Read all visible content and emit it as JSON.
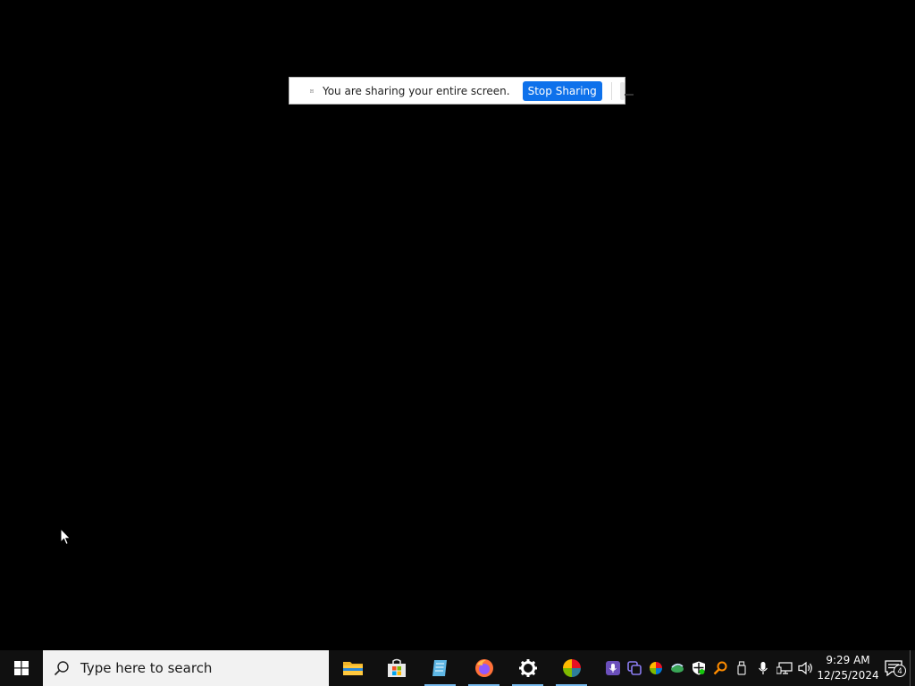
{
  "share_bar": {
    "message": "You are sharing your entire screen.",
    "stop_label": "Stop Sharing"
  },
  "taskbar": {
    "search_placeholder": "Type here to search",
    "apps": [
      {
        "name": "file-explorer",
        "active": false
      },
      {
        "name": "microsoft-store",
        "active": false
      },
      {
        "name": "notepad",
        "active": true
      },
      {
        "name": "firefox",
        "active": true
      },
      {
        "name": "settings",
        "active": true
      },
      {
        "name": "color-app",
        "active": true
      }
    ],
    "clock": {
      "time": "9:29 AM",
      "date": "12/25/2024"
    },
    "notification_count": "4"
  },
  "colors": {
    "accent": "#0e71eb",
    "taskbar_bg": "#101010",
    "active_indicator": "#76b9ed"
  }
}
